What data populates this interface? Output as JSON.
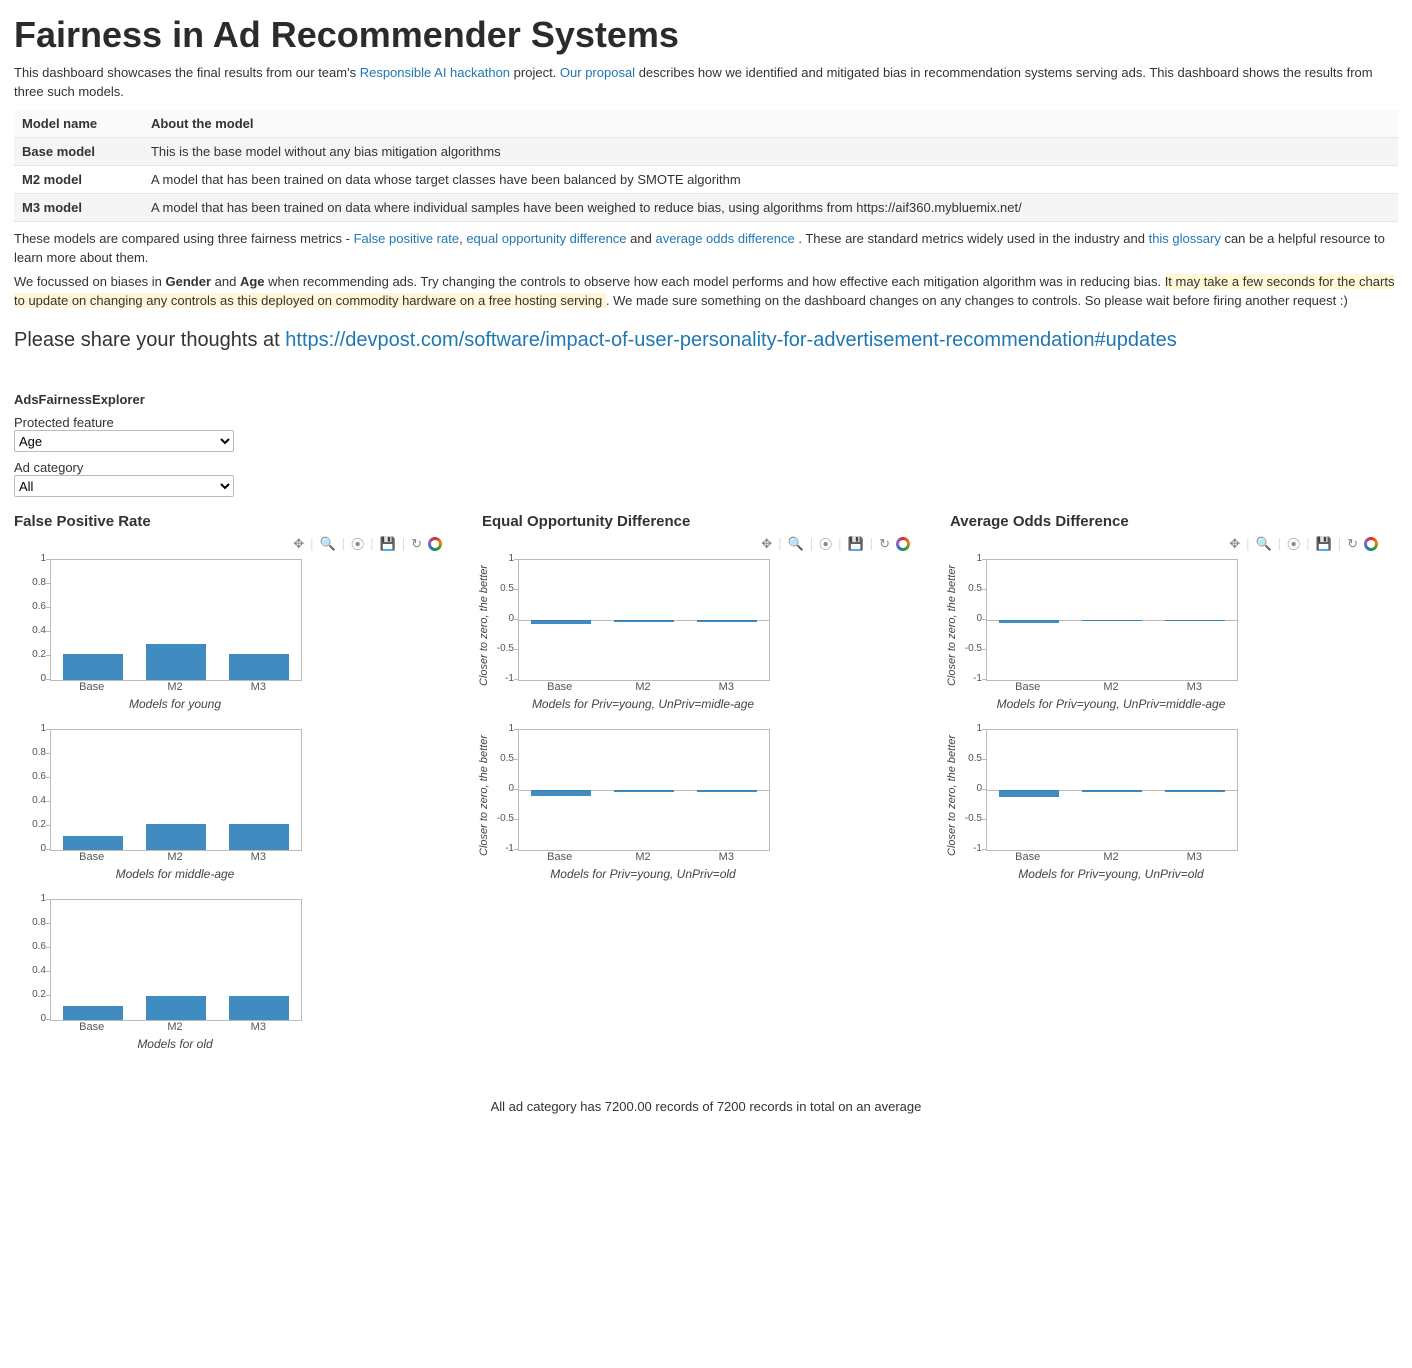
{
  "title": "Fairness in Ad Recommender Systems",
  "intro": {
    "p1_a": "This dashboard showcases the final results from our team's ",
    "hackathon_link": "Responsible AI hackathon",
    "p1_b": " project. ",
    "proposal_link": "Our proposal",
    "p1_c": " describes how we identified and mitigated bias in recommendation systems serving ads. This dashboard shows the results from three such models."
  },
  "model_table": {
    "headers": [
      "Model name",
      "About the model"
    ],
    "rows": [
      [
        "Base model",
        "This is the base model without any bias mitigation algorithms"
      ],
      [
        "M2 model",
        "A model that has been trained on data whose target classes have been balanced by SMOTE algorithm"
      ],
      [
        "M3 model",
        "A model that has been trained on data where individual samples have been weighed to reduce bias, using algorithms from https://aif360.mybluemix.net/"
      ]
    ]
  },
  "metrics_para": {
    "a": "These models are compared using three fairness metrics - ",
    "l1": "False positive rate",
    "sep1": ", ",
    "l2": "equal opportunity difference",
    "sep2": " and ",
    "l3": "average odds difference",
    "b": ". These are standard metrics widely used in the industry and ",
    "gloss": "this glossary",
    "c": " can be a helpful resource to learn more about them."
  },
  "focus_para": {
    "a": "We focussed on biases in ",
    "b1": "Gender",
    "mid": " and ",
    "b2": "Age",
    "c": " when recommending ads. Try changing the controls to observe how each model performs and how effective each mitigation algorithm was in reducing bias. ",
    "hl": " It may take a few seconds for the charts to update on changing any controls as this deployed on commodity hardware on a free hosting serving ",
    "d": ". We made sure something on the dashboard changes on any changes to controls. So please wait before firing another request :)"
  },
  "feedback": {
    "pre": "Please share your thoughts at ",
    "url": "https://devpost.com/software/impact-of-user-personality-for-advertisement-recommendation#updates"
  },
  "widget": {
    "title": "AdsFairnessExplorer",
    "control1_label": "Protected feature",
    "control1_value": "Age",
    "control2_label": "Ad category",
    "control2_value": "All"
  },
  "panels": {
    "fpr": "False Positive Rate",
    "eod": "Equal Opportunity Difference",
    "aod": "Average Odds Difference"
  },
  "x_labels": [
    "Base",
    "M2",
    "M3"
  ],
  "fpr_ylabels": [
    "0",
    "0.2",
    "0.4",
    "0.6",
    "0.8",
    "1"
  ],
  "diff_ylabels": [
    "-1",
    "-0.5",
    "0",
    "0.5",
    "1"
  ],
  "axis_label_diff": "Closer to zero, the better",
  "footer": "All ad category has 7200.00 records of 7200 records in total on an average",
  "chart_data": [
    {
      "id": "fpr-young",
      "type": "bar",
      "title": "Models for young",
      "categories": [
        "Base",
        "M2",
        "M3"
      ],
      "values": [
        0.22,
        0.3,
        0.22
      ],
      "ylim": [
        0,
        1
      ],
      "ylabel": "",
      "panel": "False Positive Rate"
    },
    {
      "id": "fpr-middle",
      "type": "bar",
      "title": "Models for middle-age",
      "categories": [
        "Base",
        "M2",
        "M3"
      ],
      "values": [
        0.12,
        0.22,
        0.22
      ],
      "ylim": [
        0,
        1
      ],
      "ylabel": "",
      "panel": "False Positive Rate"
    },
    {
      "id": "fpr-old",
      "type": "bar",
      "title": "Models for old",
      "categories": [
        "Base",
        "M2",
        "M3"
      ],
      "values": [
        0.12,
        0.2,
        0.2
      ],
      "ylim": [
        0,
        1
      ],
      "ylabel": "",
      "panel": "False Positive Rate"
    },
    {
      "id": "eod-midage",
      "type": "bar",
      "title": "Models for Priv=young, UnPriv=midle-age",
      "categories": [
        "Base",
        "M2",
        "M3"
      ],
      "values": [
        -0.06,
        -0.03,
        -0.03
      ],
      "ylim": [
        -1,
        1
      ],
      "ylabel": "Closer to zero, the better",
      "panel": "Equal Opportunity Difference"
    },
    {
      "id": "eod-old",
      "type": "bar",
      "title": "Models for Priv=young, UnPriv=old",
      "categories": [
        "Base",
        "M2",
        "M3"
      ],
      "values": [
        -0.1,
        -0.03,
        -0.03
      ],
      "ylim": [
        -1,
        1
      ],
      "ylabel": "Closer to zero, the better",
      "panel": "Equal Opportunity Difference"
    },
    {
      "id": "aod-midage",
      "type": "bar",
      "title": "Models for Priv=young, UnPriv=middle-age",
      "categories": [
        "Base",
        "M2",
        "M3"
      ],
      "values": [
        -0.05,
        -0.02,
        -0.02
      ],
      "ylim": [
        -1,
        1
      ],
      "ylabel": "Closer to zero, the better",
      "panel": "Average Odds Difference"
    },
    {
      "id": "aod-old",
      "type": "bar",
      "title": "Models for Priv=young, UnPriv=old",
      "categories": [
        "Base",
        "M2",
        "M3"
      ],
      "values": [
        -0.12,
        -0.03,
        -0.03
      ],
      "ylim": [
        -1,
        1
      ],
      "ylabel": "Closer to zero, the better",
      "panel": "Average Odds Difference"
    }
  ]
}
